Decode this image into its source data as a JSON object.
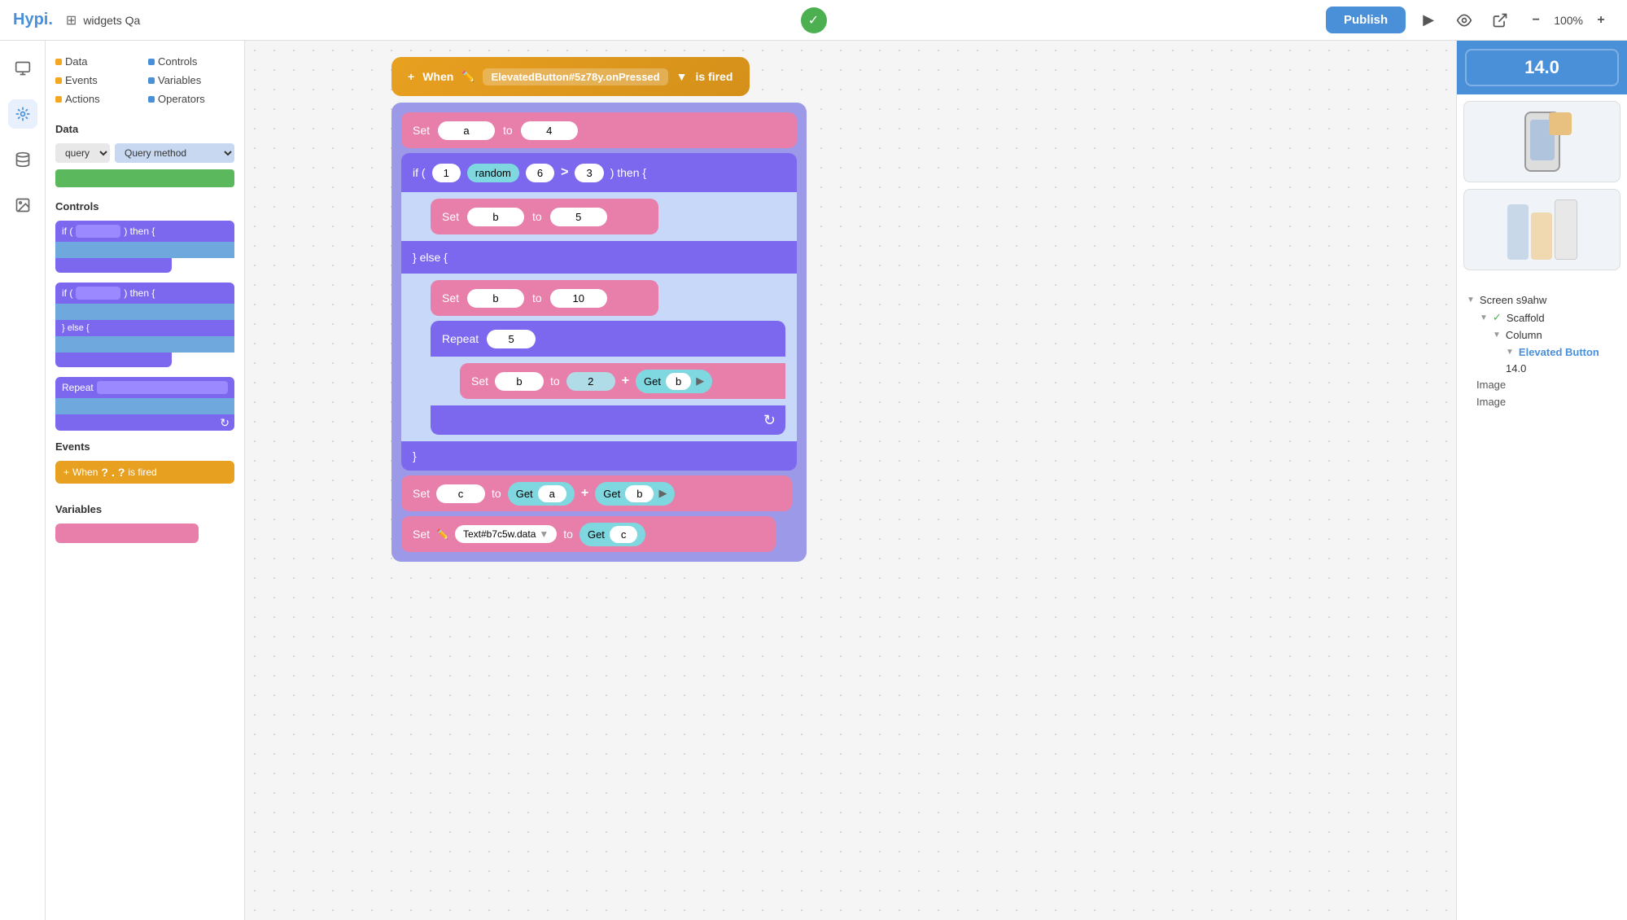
{
  "topbar": {
    "logo": "Hypi.",
    "project_icon": "⊞",
    "project_name": "widgets Qa",
    "publish_label": "Publish",
    "zoom_level": "100%",
    "play_icon": "▶",
    "eye_icon": "👁",
    "external_icon": "↗",
    "minus_icon": "−",
    "plus_icon": "+"
  },
  "left_categories": [
    {
      "label": "Data",
      "color": "orange"
    },
    {
      "label": "Controls",
      "color": "blue"
    },
    {
      "label": "Events",
      "color": "orange"
    },
    {
      "label": "Variables",
      "color": "blue"
    },
    {
      "label": "Actions",
      "color": "orange"
    },
    {
      "label": "Operators",
      "color": "blue"
    }
  ],
  "sections": {
    "data_label": "Data",
    "controls_label": "Controls",
    "events_label": "Events",
    "variables_label": "Variables"
  },
  "canvas": {
    "when_block": {
      "prefix": "When",
      "widget": "ElevatedButton#5z78y.onPressed",
      "suffix": "is fired"
    },
    "set_a": {
      "label": "Set",
      "var": "a",
      "to": "to",
      "value": "4"
    },
    "if_block": {
      "prefix": "if (",
      "left": "1",
      "op": "random",
      "right": "6",
      "comparator": ">",
      "compare_val": "3",
      "suffix": ") then {"
    },
    "set_b_5": {
      "label": "Set",
      "var": "b",
      "to": "to",
      "value": "5"
    },
    "else_label": "} else {",
    "set_b_10": {
      "label": "Set",
      "var": "b",
      "to": "to",
      "value": "10"
    },
    "repeat_block": {
      "label": "Repeat",
      "value": "5"
    },
    "set_b_expr": {
      "label": "Set",
      "var": "b",
      "to": "to",
      "val1": "2",
      "plus": "+",
      "get": "Get",
      "get_var": "b"
    },
    "close_brace": "}",
    "set_c_expr": {
      "label": "Set",
      "var": "c",
      "to": "to",
      "get1": "Get",
      "get1_var": "a",
      "plus": "+",
      "get2": "Get",
      "get2_var": "b"
    },
    "set_text": {
      "label": "Set",
      "target": "Text#b7c5w.data",
      "to": "to",
      "get": "Get",
      "get_var": "c"
    }
  },
  "right_panel": {
    "value": "14.0",
    "tree": [
      {
        "label": "Screen s9ahw",
        "level": 0,
        "expanded": true
      },
      {
        "label": "Scaffold",
        "level": 1,
        "expanded": true,
        "checked": true
      },
      {
        "label": "Column",
        "level": 2,
        "expanded": true
      },
      {
        "label": "Elevated Button",
        "level": 3,
        "selected": true
      }
    ],
    "value_row": "14.0",
    "props": [
      {
        "label": "Image"
      },
      {
        "label": "Image"
      }
    ]
  }
}
